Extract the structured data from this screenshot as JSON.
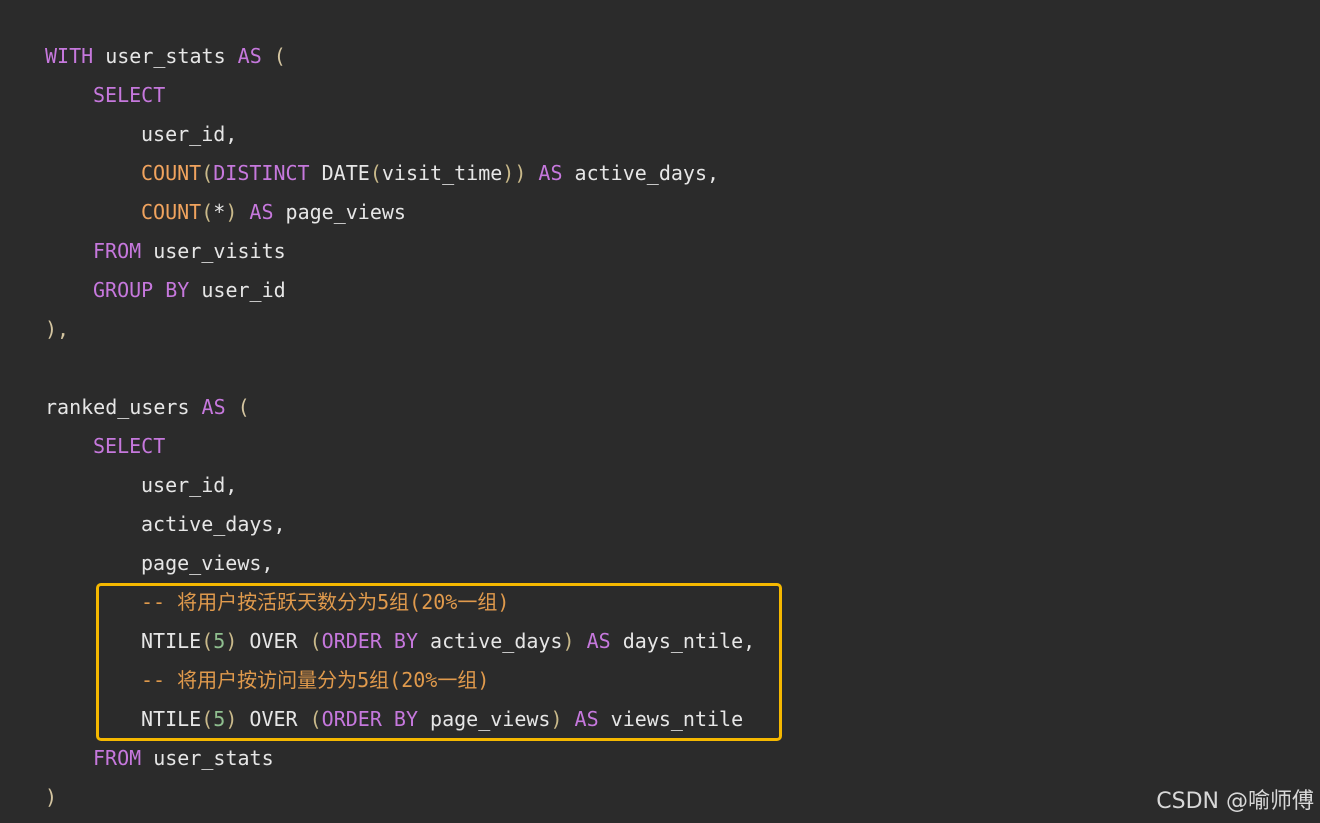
{
  "code": {
    "lines": [
      {
        "indent": 0,
        "tokens": [
          {
            "t": "kw",
            "v": "WITH"
          },
          {
            "t": "id",
            "v": " user_stats "
          },
          {
            "t": "kw",
            "v": "AS"
          },
          {
            "t": "punc",
            "v": " ("
          }
        ]
      },
      {
        "indent": 1,
        "tokens": [
          {
            "t": "kw",
            "v": "SELECT"
          }
        ]
      },
      {
        "indent": 2,
        "tokens": [
          {
            "t": "id",
            "v": "user_id,"
          }
        ]
      },
      {
        "indent": 2,
        "tokens": [
          {
            "t": "fn2",
            "v": "COUNT"
          },
          {
            "t": "paren",
            "v": "("
          },
          {
            "t": "kw",
            "v": "DISTINCT"
          },
          {
            "t": "id",
            "v": " DATE"
          },
          {
            "t": "paren",
            "v": "("
          },
          {
            "t": "id",
            "v": "visit_time"
          },
          {
            "t": "paren",
            "v": "))"
          },
          {
            "t": "id",
            "v": " "
          },
          {
            "t": "kw",
            "v": "AS"
          },
          {
            "t": "id",
            "v": " active_days,"
          }
        ]
      },
      {
        "indent": 2,
        "tokens": [
          {
            "t": "fn2",
            "v": "COUNT"
          },
          {
            "t": "paren",
            "v": "("
          },
          {
            "t": "id",
            "v": "*"
          },
          {
            "t": "paren",
            "v": ")"
          },
          {
            "t": "id",
            "v": " "
          },
          {
            "t": "kw",
            "v": "AS"
          },
          {
            "t": "id",
            "v": " page_views"
          }
        ]
      },
      {
        "indent": 1,
        "tokens": [
          {
            "t": "kw",
            "v": "FROM"
          },
          {
            "t": "id",
            "v": " user_visits"
          }
        ]
      },
      {
        "indent": 1,
        "tokens": [
          {
            "t": "kw",
            "v": "GROUP BY"
          },
          {
            "t": "id",
            "v": " user_id"
          }
        ]
      },
      {
        "indent": 0,
        "tokens": [
          {
            "t": "punc",
            "v": "),"
          }
        ]
      },
      {
        "indent": 0,
        "tokens": []
      },
      {
        "indent": 0,
        "tokens": [
          {
            "t": "id",
            "v": "ranked_users "
          },
          {
            "t": "kw",
            "v": "AS"
          },
          {
            "t": "punc",
            "v": " ("
          }
        ]
      },
      {
        "indent": 1,
        "tokens": [
          {
            "t": "kw",
            "v": "SELECT"
          }
        ]
      },
      {
        "indent": 2,
        "tokens": [
          {
            "t": "id",
            "v": "user_id,"
          }
        ]
      },
      {
        "indent": 2,
        "tokens": [
          {
            "t": "id",
            "v": "active_days,"
          }
        ]
      },
      {
        "indent": 2,
        "tokens": [
          {
            "t": "id",
            "v": "page_views,"
          }
        ]
      },
      {
        "indent": 2,
        "tokens": [
          {
            "t": "cmt",
            "v": "-- 将用户按活跃天数分为5组(20%一组)"
          }
        ]
      },
      {
        "indent": 2,
        "tokens": [
          {
            "t": "id",
            "v": "NTILE"
          },
          {
            "t": "paren",
            "v": "("
          },
          {
            "t": "num",
            "v": "5"
          },
          {
            "t": "paren",
            "v": ")"
          },
          {
            "t": "id",
            "v": " OVER "
          },
          {
            "t": "paren",
            "v": "("
          },
          {
            "t": "kw",
            "v": "ORDER BY"
          },
          {
            "t": "id",
            "v": " active_days"
          },
          {
            "t": "paren",
            "v": ")"
          },
          {
            "t": "id",
            "v": " "
          },
          {
            "t": "kw",
            "v": "AS"
          },
          {
            "t": "id",
            "v": " days_ntile,"
          }
        ]
      },
      {
        "indent": 2,
        "tokens": [
          {
            "t": "cmt",
            "v": "-- 将用户按访问量分为5组(20%一组)"
          }
        ]
      },
      {
        "indent": 2,
        "tokens": [
          {
            "t": "id",
            "v": "NTILE"
          },
          {
            "t": "paren",
            "v": "("
          },
          {
            "t": "num",
            "v": "5"
          },
          {
            "t": "paren",
            "v": ")"
          },
          {
            "t": "id",
            "v": " OVER "
          },
          {
            "t": "paren",
            "v": "("
          },
          {
            "t": "kw",
            "v": "ORDER BY"
          },
          {
            "t": "id",
            "v": " page_views"
          },
          {
            "t": "paren",
            "v": ")"
          },
          {
            "t": "id",
            "v": " "
          },
          {
            "t": "kw",
            "v": "AS"
          },
          {
            "t": "id",
            "v": " views_ntile"
          }
        ]
      },
      {
        "indent": 1,
        "tokens": [
          {
            "t": "kw",
            "v": "FROM"
          },
          {
            "t": "id",
            "v": " user_stats"
          }
        ]
      },
      {
        "indent": 0,
        "tokens": [
          {
            "t": "punc",
            "v": ")"
          }
        ]
      }
    ]
  },
  "highlight": {
    "color": "#f5b800"
  },
  "watermark": {
    "text": "CSDN @喻师傅"
  },
  "colors": {
    "background": "#2b2b2b",
    "keyword": "#c678dd",
    "comment": "#e09a4c",
    "number": "#8fbf8f"
  }
}
